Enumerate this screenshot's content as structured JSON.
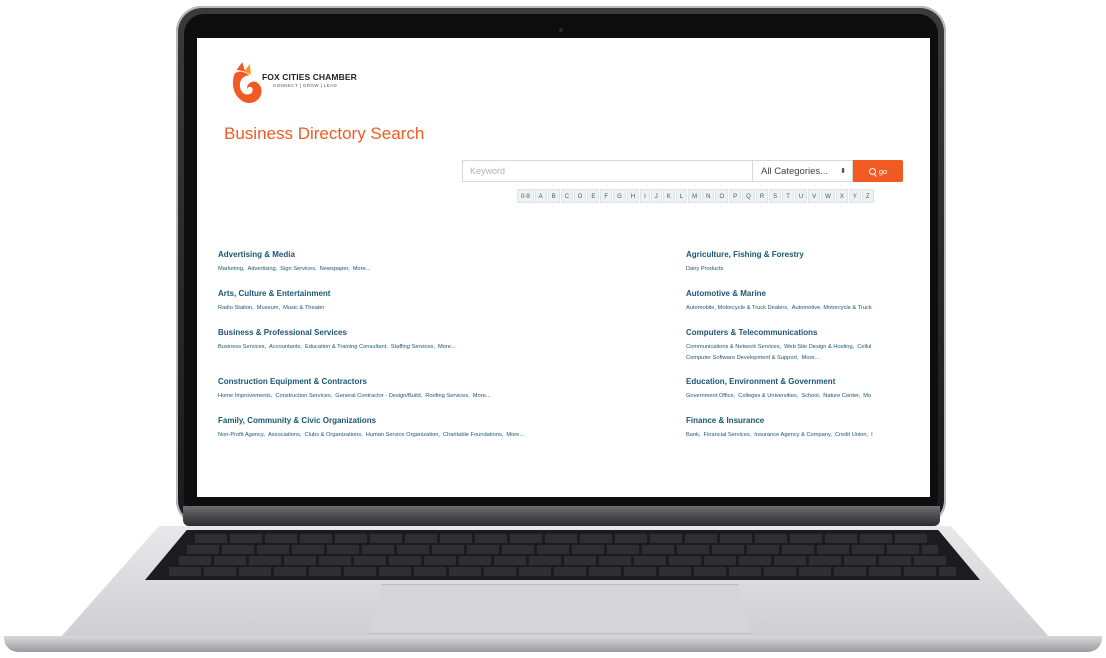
{
  "logo": {
    "name": "FOX CITIES CHAMBER",
    "tagline": "CONNECT | GROW | LEAD"
  },
  "page_title": "Business Directory Search",
  "search": {
    "keyword_placeholder": "Keyword",
    "category_selected": "All Categories...",
    "go_label": "go"
  },
  "alphabet": [
    "0-9",
    "A",
    "B",
    "C",
    "D",
    "E",
    "F",
    "G",
    "H",
    "I",
    "J",
    "K",
    "L",
    "M",
    "N",
    "O",
    "P",
    "Q",
    "R",
    "S",
    "T",
    "U",
    "V",
    "W",
    "X",
    "Y",
    "Z"
  ],
  "categories": [
    {
      "title": "Advertising & Media",
      "subs": [
        "Marketing,",
        "Advertising,",
        "Sign Services,",
        "Newspaper,",
        "More..."
      ]
    },
    {
      "title": "Agriculture, Fishing & Forestry",
      "subs": [
        "Dairy Products"
      ]
    },
    {
      "title": "Arts, Culture & Entertainment",
      "subs": [
        "Radio Station,",
        "Museum,",
        "Music & Theater"
      ]
    },
    {
      "title": "Automotive & Marine",
      "subs": [
        "Automobile, Motorcycle & Truck Dealers,",
        "Automotive, Motorcycle & Truck"
      ]
    },
    {
      "title": "Business & Professional Services",
      "subs": [
        "Business Services,",
        "Accountants,",
        "Education & Training Consultant,",
        "Staffing Services,",
        "More..."
      ]
    },
    {
      "title": "Computers & Telecommunications",
      "subs": [
        "Communications & Network Services,",
        "Web Site Design & Hosting,",
        "Cellul",
        "Computer Software Development & Support,",
        "More..."
      ]
    },
    {
      "title": "Construction Equipment & Contractors",
      "subs": [
        "Home Improvements,",
        "Construction Services,",
        "General Contractor - Design/Build,",
        "Roofing Services,",
        "More..."
      ]
    },
    {
      "title": "Education, Environment & Government",
      "subs": [
        "Government Office,",
        "Colleges & Universities,",
        "School,",
        "Nature Center,",
        "Mo"
      ]
    },
    {
      "title": "Family, Community & Civic Organizations",
      "subs": [
        "Non-Profit Agency,",
        "Associations,",
        "Clubs & Organizations,",
        "Human Service Organization,",
        "Charitable Foundations,",
        "More..."
      ]
    },
    {
      "title": "Finance & Insurance",
      "subs": [
        "Bank,",
        "Financial Services,",
        "Insurance Agency & Company,",
        "Credit Union,",
        "I"
      ]
    }
  ],
  "colors": {
    "accent": "#f15a22",
    "link": "#1b5673"
  }
}
